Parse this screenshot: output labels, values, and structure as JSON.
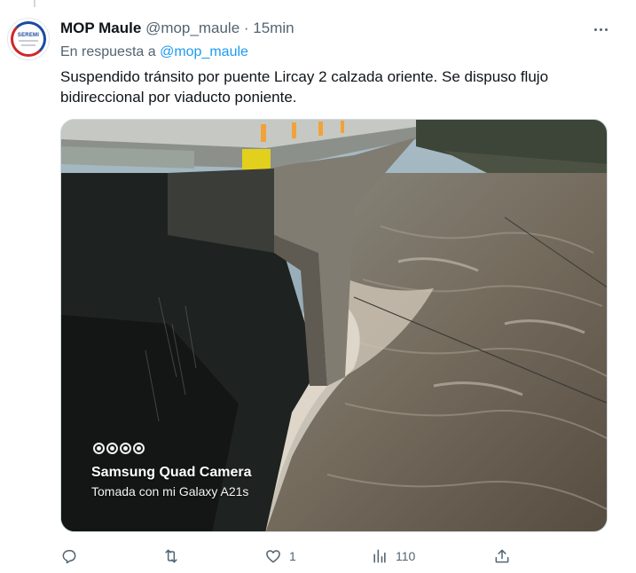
{
  "tweet": {
    "author_name": "MOP Maule",
    "handle": "@mop_maule",
    "separator": "·",
    "time": "15min",
    "reply_prefix": "En respuesta a",
    "reply_handle": "@mop_maule",
    "text": "Suspendido tránsito por puente Lircay 2 calzada oriente. Se dispuso flujo bidireccional por viaducto poniente.",
    "avatar_label": "SEREMI"
  },
  "media": {
    "camera_title": "Samsung Quad Camera",
    "camera_subtitle": "Tomada con mi Galaxy A21s"
  },
  "actions": {
    "reply_count": "",
    "retweet_count": "",
    "like_count": "1",
    "views_count": "110"
  },
  "icons": {
    "reply": "reply-icon",
    "retweet": "retweet-icon",
    "like": "heart-icon",
    "views": "views-icon",
    "share": "share-icon",
    "more": "more-icon"
  },
  "colors": {
    "accent": "#1d9bf0",
    "muted": "#536471",
    "text": "#0f1419"
  }
}
